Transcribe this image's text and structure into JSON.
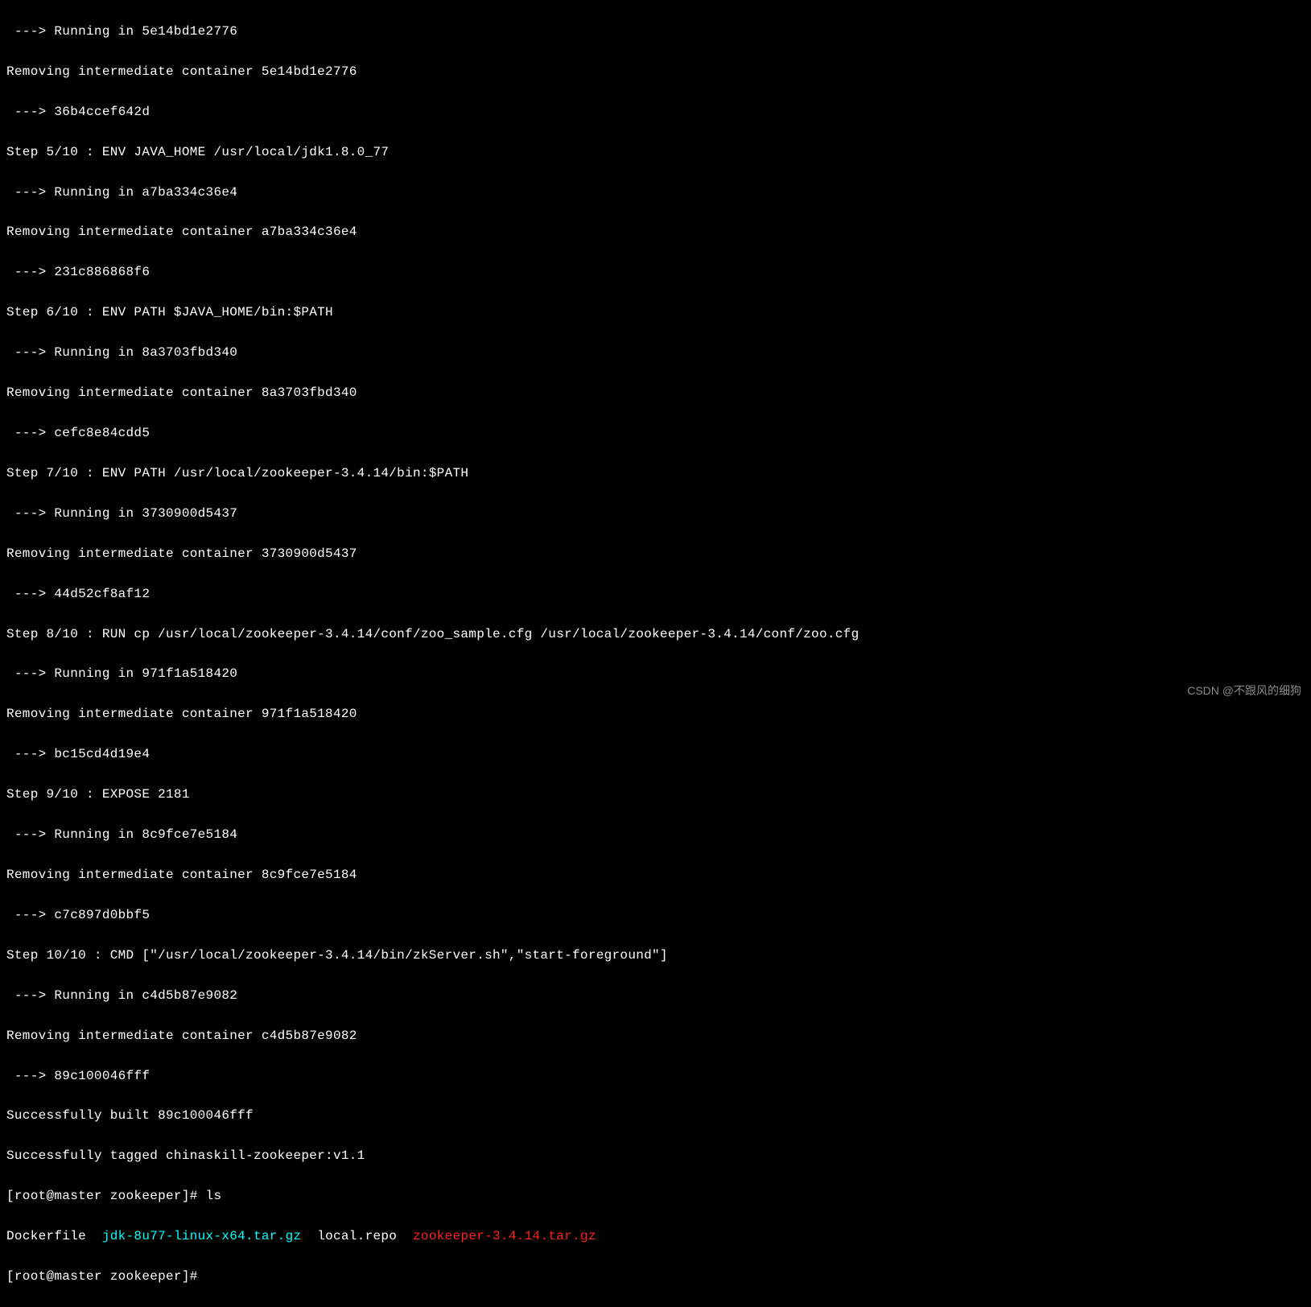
{
  "lines": [
    {
      "text": " ---> Running in 5e14bd1e2776"
    },
    {
      "text": "Removing intermediate container 5e14bd1e2776"
    },
    {
      "text": " ---> 36b4ccef642d"
    },
    {
      "text": "Step 5/10 : ENV JAVA_HOME /usr/local/jdk1.8.0_77"
    },
    {
      "text": " ---> Running in a7ba334c36e4"
    },
    {
      "text": "Removing intermediate container a7ba334c36e4"
    },
    {
      "text": " ---> 231c886868f6"
    },
    {
      "text": "Step 6/10 : ENV PATH $JAVA_HOME/bin:$PATH"
    },
    {
      "text": " ---> Running in 8a3703fbd340"
    },
    {
      "text": "Removing intermediate container 8a3703fbd340"
    },
    {
      "text": " ---> cefc8e84cdd5"
    },
    {
      "text": "Step 7/10 : ENV PATH /usr/local/zookeeper-3.4.14/bin:$PATH"
    },
    {
      "text": " ---> Running in 3730900d5437"
    },
    {
      "text": "Removing intermediate container 3730900d5437"
    },
    {
      "text": " ---> 44d52cf8af12"
    },
    {
      "text": "Step 8/10 : RUN cp /usr/local/zookeeper-3.4.14/conf/zoo_sample.cfg /usr/local/zookeeper-3.4.14/conf/zoo.cfg"
    },
    {
      "text": " ---> Running in 971f1a518420"
    },
    {
      "text": "Removing intermediate container 971f1a518420"
    },
    {
      "text": " ---> bc15cd4d19e4"
    },
    {
      "text": "Step 9/10 : EXPOSE 2181"
    },
    {
      "text": " ---> Running in 8c9fce7e5184"
    },
    {
      "text": "Removing intermediate container 8c9fce7e5184"
    },
    {
      "text": " ---> c7c897d0bbf5"
    },
    {
      "text": "Step 10/10 : CMD [\"/usr/local/zookeeper-3.4.14/bin/zkServer.sh\",\"start-foreground\"]"
    },
    {
      "text": " ---> Running in c4d5b87e9082"
    },
    {
      "text": "Removing intermediate container c4d5b87e9082"
    },
    {
      "text": " ---> 89c100046fff"
    },
    {
      "text": "Successfully built 89c100046fff"
    },
    {
      "text": "Successfully tagged chinaskill-zookeeper:v1.1"
    }
  ],
  "prompt1": {
    "prefix": "[root@master zookeeper]# ",
    "command": "ls"
  },
  "ls_output": {
    "file1": "Dockerfile",
    "sep1": "  ",
    "file2": "jdk-8u77-linux-x64.tar.gz",
    "sep2": "  ",
    "file3": "local.repo",
    "sep3": "  ",
    "file4": "zookeeper-3.4.14.tar.gz"
  },
  "prompt2": {
    "prefix": "[root@master zookeeper]# "
  },
  "watermark": "CSDN @不跟风的细狗"
}
